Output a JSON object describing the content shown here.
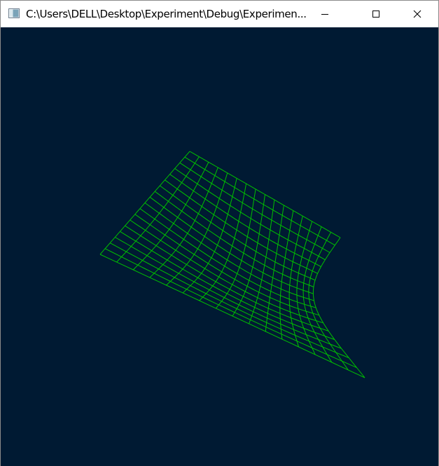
{
  "window": {
    "title": "C:\\Users\\DELL\\Desktop\\Experiment\\Debug\\Experimen...",
    "app_icon": "console-app-icon",
    "buttons": {
      "minimize_icon": "minimize-icon",
      "maximize_icon": "maximize-icon",
      "close_icon": "close-icon"
    }
  },
  "viewport": {
    "background_color": "#001a33",
    "mesh_color": "#00c000",
    "shape": "wireframe-surface"
  }
}
